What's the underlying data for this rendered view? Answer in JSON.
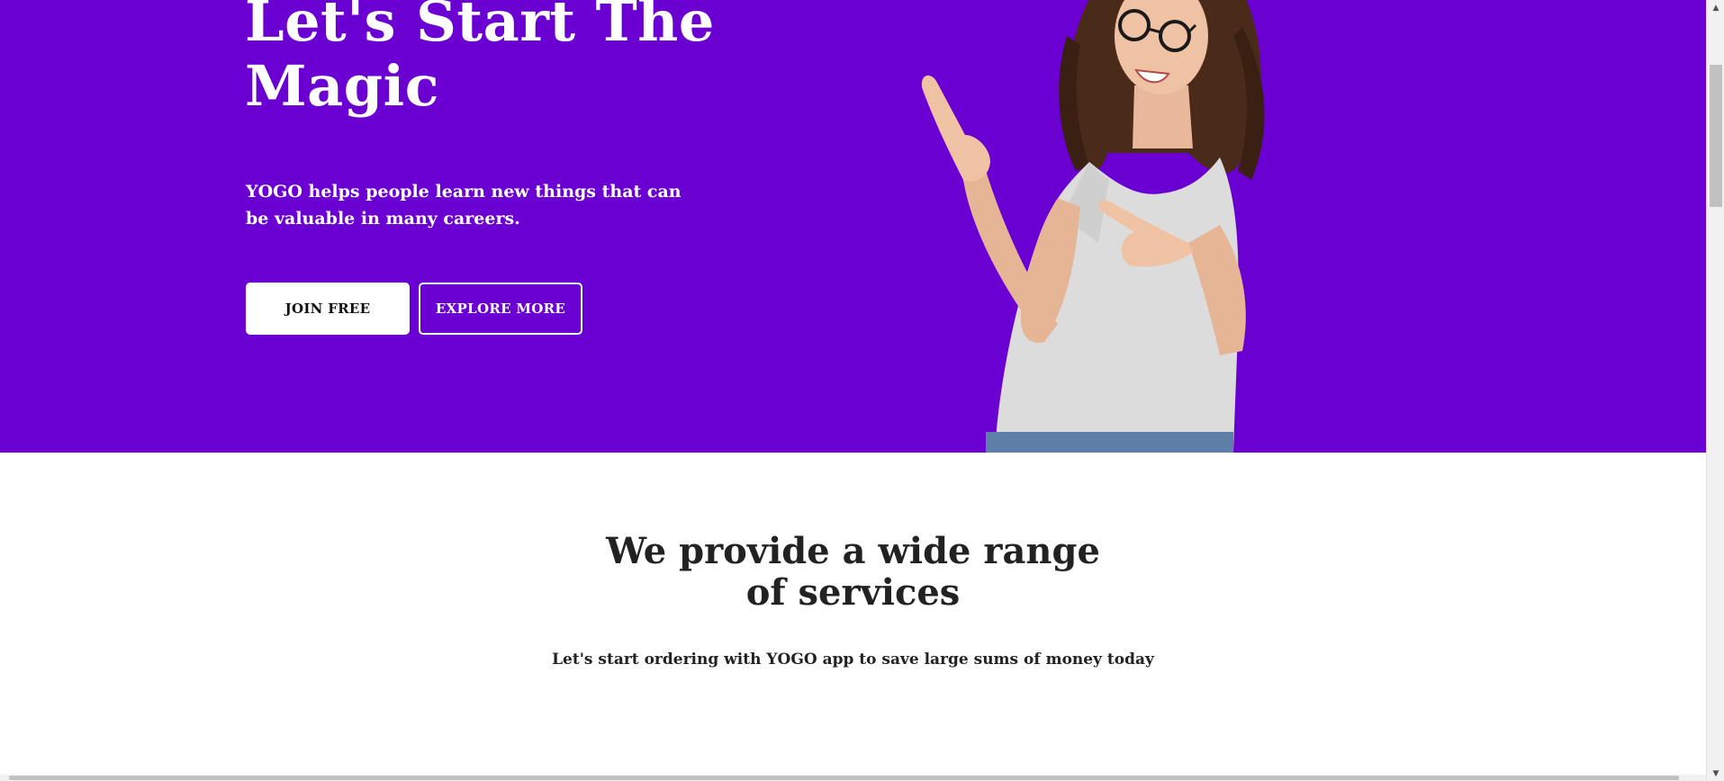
{
  "hero": {
    "title_line1": "Let's Start The",
    "title_line2": "Magic",
    "description_line1": "YOGO helps people learn new things that can",
    "description_line2": "be valuable in many careers.",
    "join_label": "JOIN FREE",
    "explore_label": "EXPLORE MORE",
    "background_color": "#6a00d2"
  },
  "services": {
    "title_line1": "We provide a wide range",
    "title_line2": "of services",
    "subtitle": "Let's start ordering with YOGO app to save large sums of money today"
  },
  "scrollbar": {
    "up_icon": "arrow-up-icon",
    "down_icon": "arrow-down-icon"
  }
}
